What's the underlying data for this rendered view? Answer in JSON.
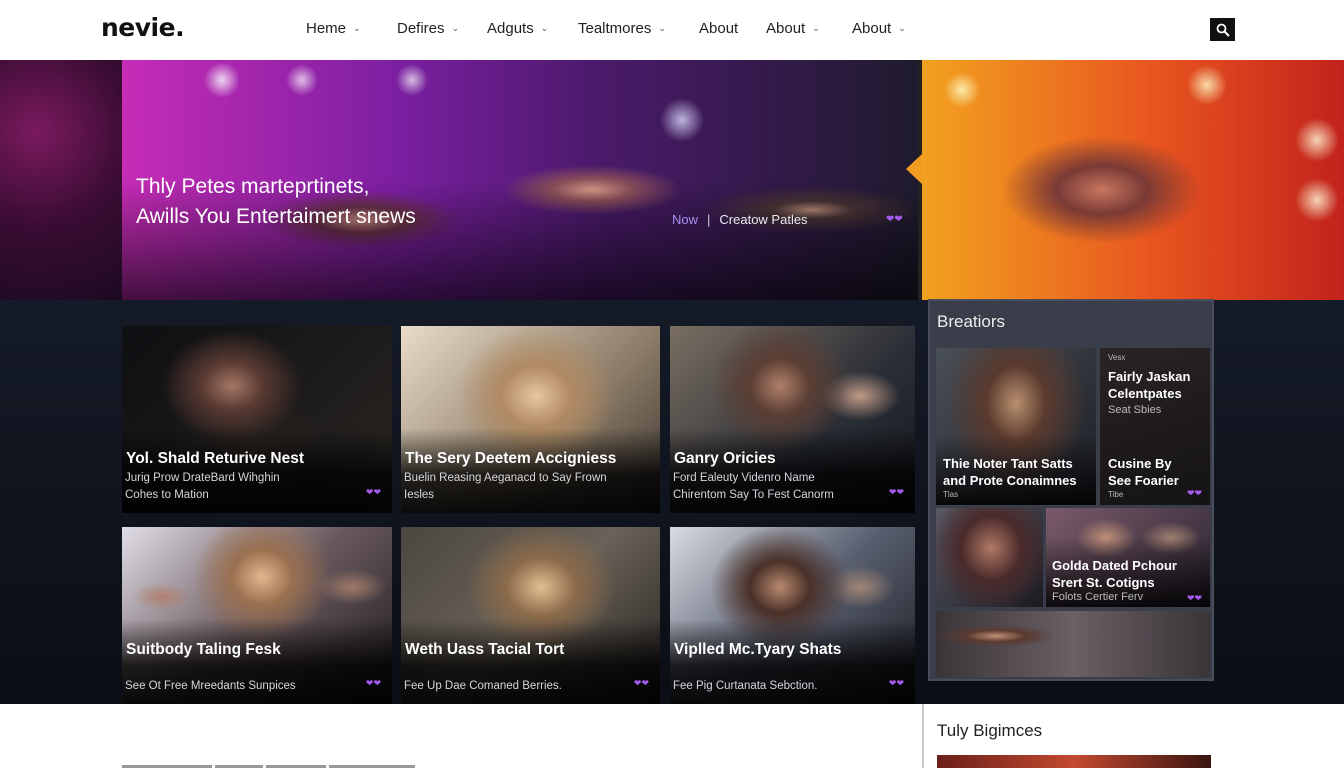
{
  "brand": {
    "logo": "nevie."
  },
  "nav": {
    "items": [
      {
        "label": "Heme",
        "dropdown": true
      },
      {
        "label": "Defires",
        "dropdown": true
      },
      {
        "label": "Adguts",
        "dropdown": true
      },
      {
        "label": "Tealtmores",
        "dropdown": true
      },
      {
        "label": "About",
        "dropdown": false
      },
      {
        "label": "About",
        "dropdown": true
      },
      {
        "label": "About",
        "dropdown": true
      }
    ],
    "search_icon": "search-icon"
  },
  "hero": {
    "title_line1": "Thly Petes martepr​tinets,",
    "title_line2": "Awills You Entertaimert snews",
    "meta_now": "Now",
    "meta_separator": "|",
    "meta_text": "Creatow Patles",
    "heart_icon": "heart-icon"
  },
  "cards": [
    {
      "title": "Yol. Shald Returive Nest",
      "desc1": "Jurig Prow DrateBard Wihghin",
      "desc2": "Cohes to Mation"
    },
    {
      "title": "The Sery Deetem Accigniess",
      "desc1": "Buelin Reasing Aeganacd to Say Frown",
      "desc2": "Iesles"
    },
    {
      "title": "Ganry Oricies",
      "desc1": "Ford Ealeuty Videnro Name",
      "desc2": "Chirentom Say To Fest Canorm"
    },
    {
      "title": "Suitbody Taling Fesk",
      "desc1": "See Ot Free Mreedants Sunpices",
      "desc2": ""
    },
    {
      "title": "Weth Uass Tacial Tort",
      "desc1": "Fee Up Dae Comaned Berries.",
      "desc2": ""
    },
    {
      "title": "Viplled Mc.Tyary Shats",
      "desc1": "Fee Pig Curtanata Sebction.",
      "desc2": ""
    }
  ],
  "sidebar": {
    "heading": "Breatiors",
    "card1": {
      "title_line1": "Thie Noter Tant Satts",
      "title_line2": "and Prote Conaimnes",
      "sub": "Tlas"
    },
    "card2": {
      "kicker": "Vesx",
      "title_line1": "Fairly Jaskan",
      "title_line2": "Celentpates",
      "sub": "Seat Sbies",
      "title2_line1": "Cusine By",
      "title2_line2": "See Foarier",
      "sub2": "Tibe"
    },
    "card3": {
      "title_line1": "Golda Dated Pchour",
      "title_line2": "Srert St. Cotigns",
      "sub": "Folots Certier Ferv"
    }
  },
  "bottom": {
    "heading": "Tuly Bigimces"
  },
  "colors": {
    "accent_purple": "#a55bf0",
    "hero_arrow": "#f29b22",
    "dark_bg": "#0f131c"
  }
}
